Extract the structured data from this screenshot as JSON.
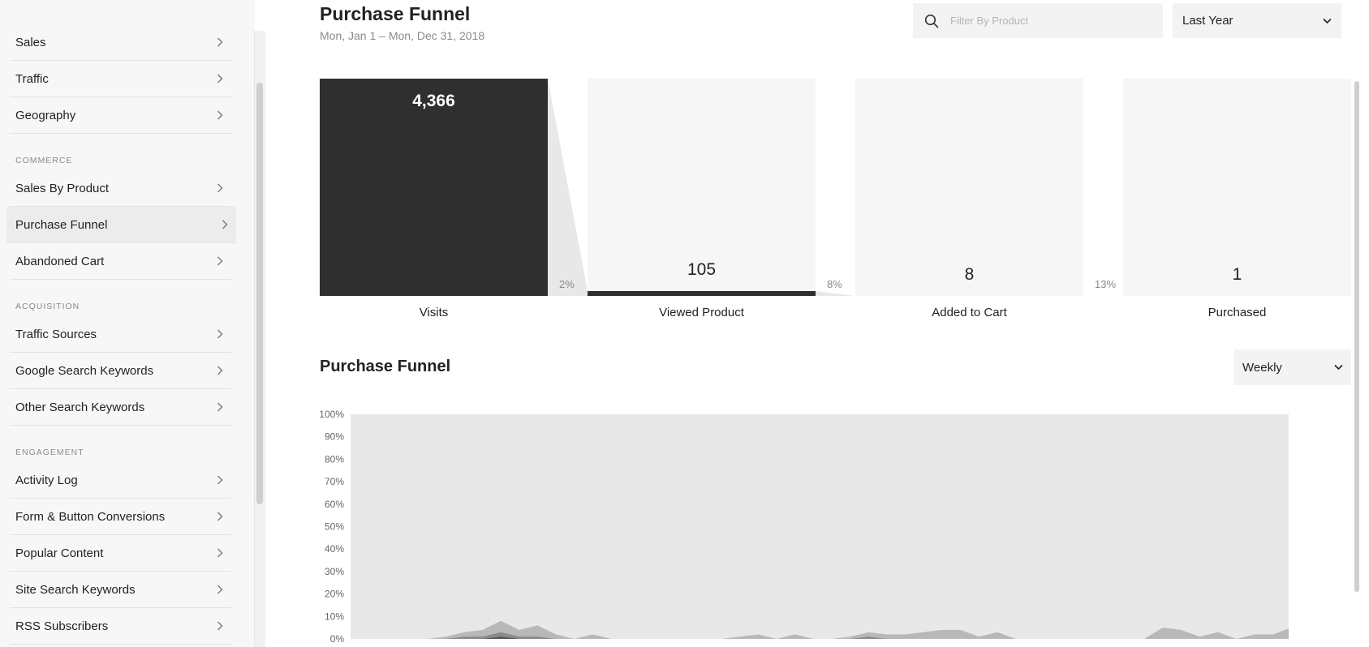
{
  "sidebar": {
    "groups": [
      {
        "heading": "",
        "items": [
          {
            "label": "Sales",
            "active": false
          },
          {
            "label": "Traffic",
            "active": false
          },
          {
            "label": "Geography",
            "active": false
          }
        ]
      },
      {
        "heading": "COMMERCE",
        "items": [
          {
            "label": "Sales By Product",
            "active": false
          },
          {
            "label": "Purchase Funnel",
            "active": true
          },
          {
            "label": "Abandoned Cart",
            "active": false
          }
        ]
      },
      {
        "heading": "ACQUISITION",
        "items": [
          {
            "label": "Traffic Sources",
            "active": false
          },
          {
            "label": "Google Search Keywords",
            "active": false
          },
          {
            "label": "Other Search Keywords",
            "active": false
          }
        ]
      },
      {
        "heading": "ENGAGEMENT",
        "items": [
          {
            "label": "Activity Log",
            "active": false
          },
          {
            "label": "Form & Button Conversions",
            "active": false
          },
          {
            "label": "Popular Content",
            "active": false
          },
          {
            "label": "Site Search Keywords",
            "active": false
          },
          {
            "label": "RSS Subscribers",
            "active": false
          }
        ]
      }
    ]
  },
  "header": {
    "title": "Purchase Funnel",
    "date_range": "Mon, Jan 1 – Mon, Dec 31, 2018",
    "search_placeholder": "Filter By Product",
    "range_value": "Last Year"
  },
  "funnel": {
    "stages": [
      {
        "name": "Visits",
        "count": "4,366",
        "value": 4366
      },
      {
        "name": "Viewed Product",
        "count": "105",
        "value": 105
      },
      {
        "name": "Added to Cart",
        "count": "8",
        "value": 8
      },
      {
        "name": "Purchased",
        "count": "1",
        "value": 1
      }
    ],
    "conversions": [
      "2%",
      "8%",
      "13%"
    ]
  },
  "chart_section": {
    "title": "Purchase Funnel",
    "interval_value": "Weekly"
  },
  "chart_data": {
    "type": "area",
    "title": "",
    "xlabel": "",
    "ylabel": "",
    "ylim": [
      0,
      100
    ],
    "yticks": [
      "0%",
      "10%",
      "20%",
      "30%",
      "40%",
      "50%",
      "60%",
      "70%",
      "80%",
      "90%",
      "100%"
    ],
    "grid": false,
    "x": [
      1,
      2,
      3,
      4,
      5,
      6,
      7,
      8,
      9,
      10,
      11,
      12,
      13,
      14,
      15,
      16,
      17,
      18,
      19,
      20,
      21,
      22,
      23,
      24,
      25,
      26,
      27,
      28,
      29,
      30,
      31,
      32,
      33,
      34,
      35,
      36,
      37,
      38,
      39,
      40,
      41,
      42,
      43,
      44,
      45,
      46,
      47,
      48,
      49,
      50,
      51,
      52,
      53
    ],
    "series": [
      {
        "values": [
          0,
          0,
          0,
          0,
          0,
          1,
          3,
          4,
          8,
          4,
          6,
          2,
          0,
          2,
          0,
          0,
          0,
          0,
          0,
          0,
          0,
          1,
          2,
          0,
          2,
          0,
          0,
          1,
          3,
          2,
          2,
          3,
          4,
          4,
          1,
          3,
          0,
          0,
          0,
          0,
          0,
          0,
          0,
          0,
          5,
          4,
          1,
          3,
          0,
          2,
          2,
          5,
          4
        ]
      },
      {
        "values": [
          0,
          0,
          0,
          0,
          0,
          0,
          1,
          1,
          3,
          1,
          1,
          0,
          0,
          0,
          0,
          0,
          0,
          0,
          0,
          0,
          0,
          0,
          0,
          0,
          0,
          0,
          0,
          0,
          1,
          0,
          0,
          0,
          0,
          0,
          0,
          0,
          0,
          0,
          0,
          0,
          0,
          0,
          0,
          0,
          0,
          0,
          0,
          0,
          0,
          0,
          0,
          0,
          0
        ]
      },
      {
        "values": [
          0,
          0,
          0,
          0,
          0,
          0,
          0,
          0,
          1,
          0,
          0,
          0,
          0,
          0,
          0,
          0,
          0,
          0,
          0,
          0,
          0,
          0,
          0,
          0,
          0,
          0,
          0,
          0,
          0,
          0,
          0,
          0,
          0,
          0,
          0,
          0,
          0,
          0,
          0,
          0,
          0,
          0,
          0,
          0,
          0,
          0,
          0,
          0,
          0,
          0,
          0,
          0,
          0
        ]
      }
    ]
  },
  "colors": {
    "funnel_fill": "#2f2f2f",
    "stage_bg": "#f6f6f6",
    "chart_bg": "#e8e8e8",
    "series": [
      "#b8b8b8",
      "#8a8a8a",
      "#555555"
    ]
  },
  "icons": {
    "search": "search-icon",
    "chevron_right": "chevron-right-icon",
    "chevron_down": "chevron-down-icon"
  }
}
